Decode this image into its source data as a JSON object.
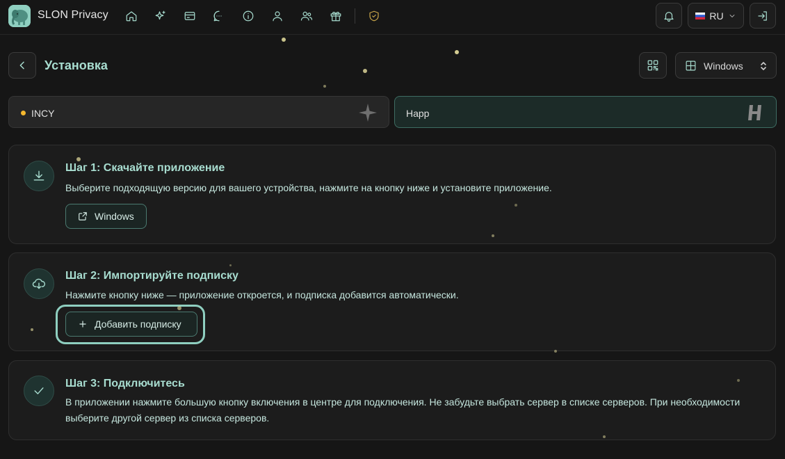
{
  "header": {
    "brand": "SLON Privacy",
    "nav_icons": [
      "home-icon",
      "sparkles-icon",
      "card-icon",
      "chat-icon",
      "info-icon",
      "user-icon",
      "users-icon",
      "gift-icon",
      "shield-icon"
    ],
    "language": "RU",
    "accent_color": "#a8ddd0"
  },
  "page": {
    "title": "Установка",
    "os_selected": "Windows"
  },
  "apps": {
    "incy": {
      "label": "INCY",
      "status_color": "#f5b82e"
    },
    "happ": {
      "label": "Happ"
    }
  },
  "steps": [
    {
      "title": "Шаг 1: Скачайте приложение",
      "description": "Выберите подходящую версию для вашего устройства, нажмите на кнопку ниже и установите приложение.",
      "button": "Windows",
      "icon": "download-icon"
    },
    {
      "title": "Шаг 2: Импортируйте подписку",
      "description": "Нажмите кнопку ниже — приложение откроется, и подписка добавится автоматически.",
      "button": "Добавить подписку",
      "icon": "cloud-download-icon"
    },
    {
      "title": "Шаг 3: Подключитесь",
      "description": "В приложении нажмите большую кнопку включения в центре для подключения. Не забудьте выбрать сервер в списке серверов. При необходимости выберите другой сервер из списка серверов.",
      "icon": "check-icon"
    }
  ]
}
